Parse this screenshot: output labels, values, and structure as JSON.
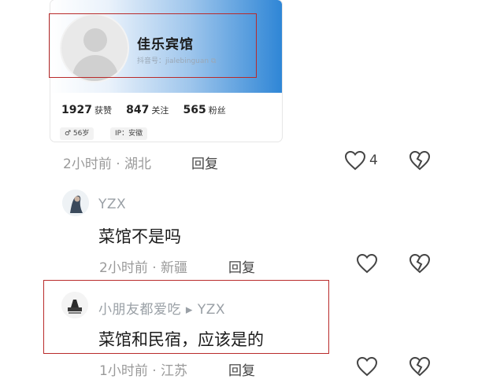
{
  "profile_card": {
    "name": "佳乐宾馆",
    "id_label": "抖音号：jialebinguan",
    "stats": [
      {
        "value": "1927",
        "label": "获赞"
      },
      {
        "value": "847",
        "label": "关注"
      },
      {
        "value": "565",
        "label": "粉丝"
      }
    ],
    "age_tag": "♂ 56岁",
    "ip_tag": "IP：安徽"
  },
  "comments": [
    {
      "meta": "2小时前 · 湖北",
      "reply_label": "回复",
      "like_count": "4"
    },
    {
      "username": "YZX",
      "text": "菜馆不是吗",
      "meta": "2小时前 · 新疆",
      "reply_label": "回复"
    },
    {
      "username": "小朋友都爱吃 ▸ YZX",
      "text": "菜馆和民宿，应该是的",
      "meta": "1小时前 · 江苏",
      "reply_label": "回复"
    }
  ],
  "icons": {
    "like": "heart-outline-icon",
    "dislike": "broken-heart-icon",
    "accent": "#b92b2b"
  }
}
